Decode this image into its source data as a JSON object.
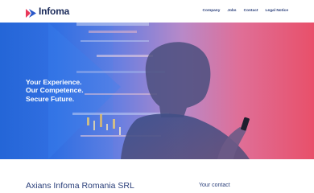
{
  "header": {
    "brand": "Infoma",
    "nav": [
      "Company",
      "Jobs",
      "Contact",
      "Legal Notice"
    ]
  },
  "hero": {
    "lines": [
      "Your Experience.",
      "Our Competence.",
      "Secure Future."
    ]
  },
  "main": {
    "company_name": "Axians Infoma Romania SRL",
    "contact_heading": "Your contact"
  },
  "colors": {
    "brand_blue": "#1b2b5a",
    "hero_left": "#1f5fd0",
    "hero_right": "#e8506a",
    "link_color": "#2a3f7a"
  }
}
